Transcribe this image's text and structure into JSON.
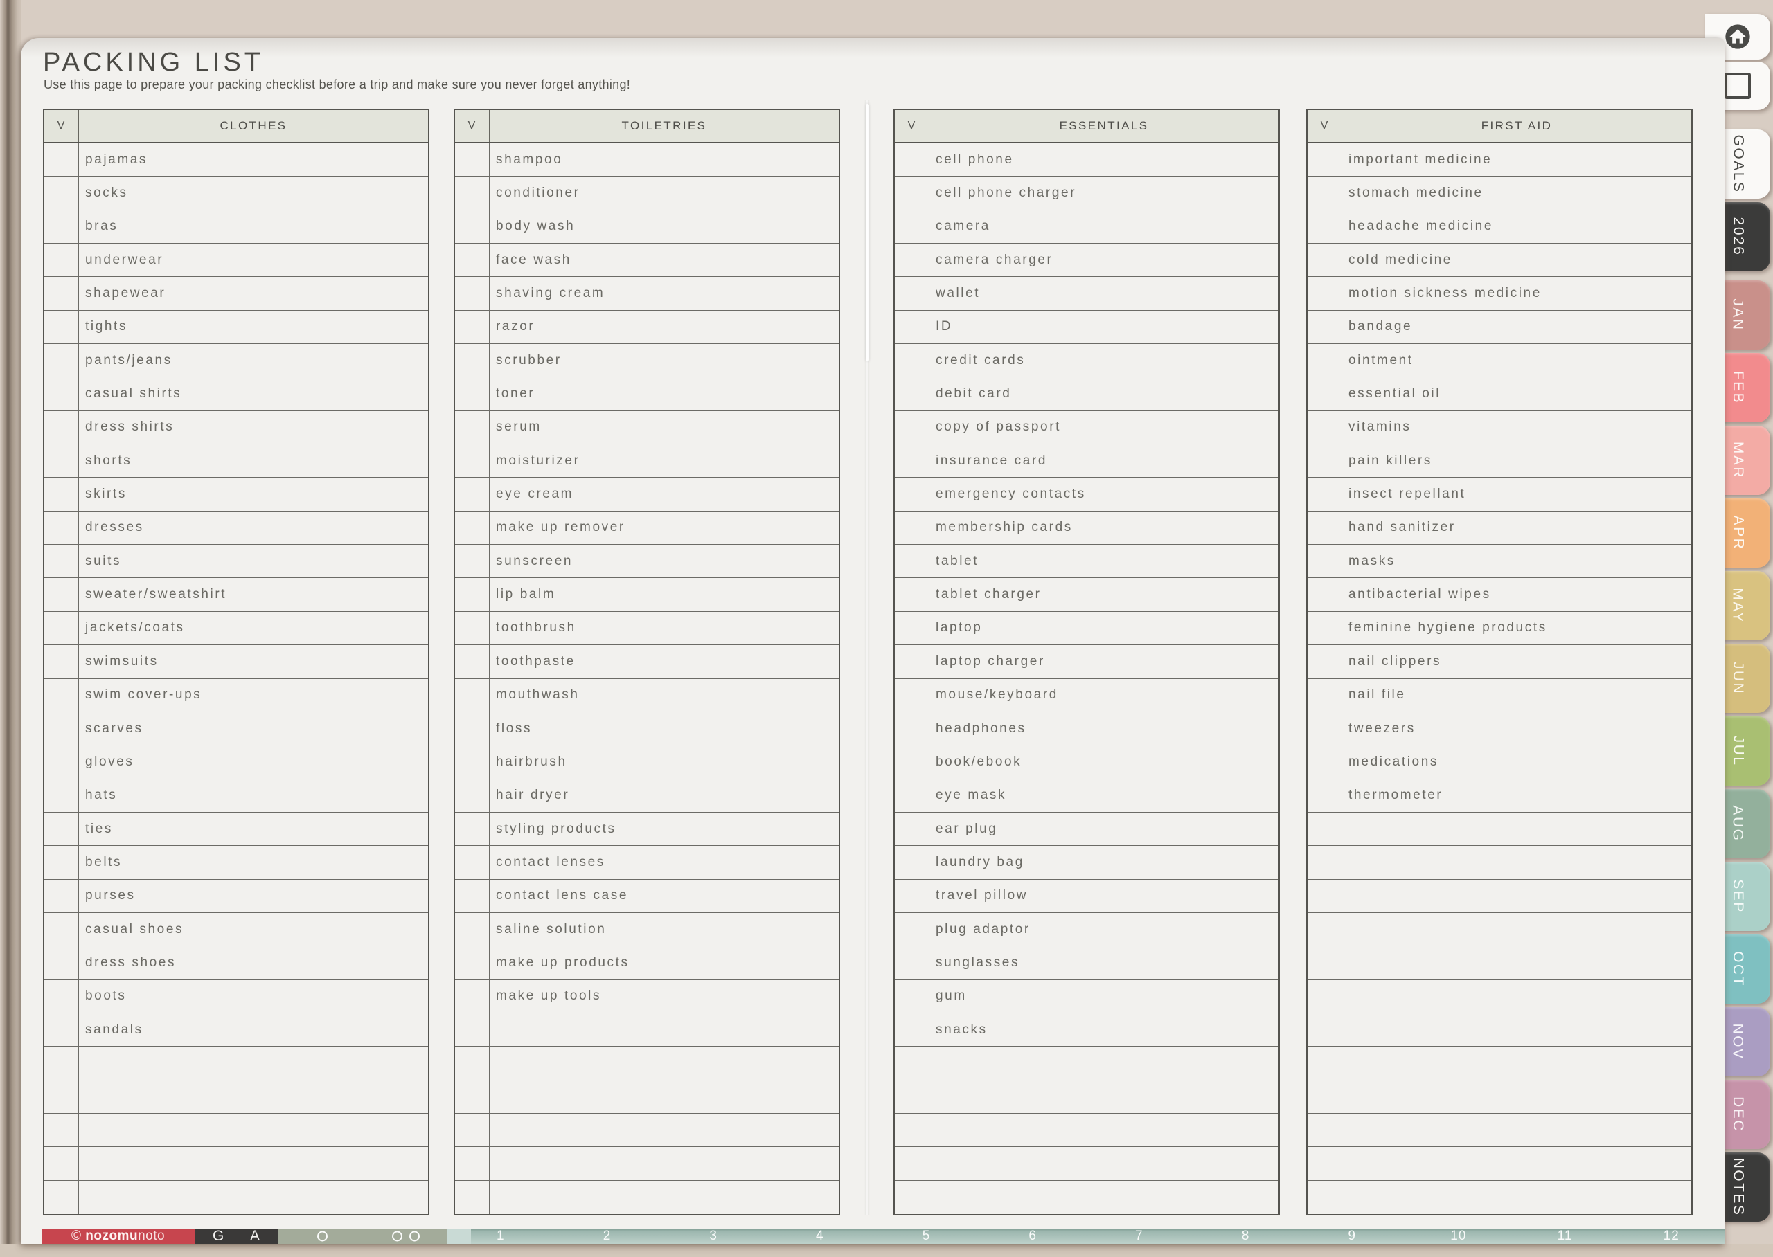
{
  "header": {
    "title": "PACKING LIST",
    "subtitle": "Use this page to prepare your packing checklist before a trip and make sure you never forget anything!"
  },
  "check_column_header": "V",
  "rows_per_table": 32,
  "tables": [
    {
      "title": "CLOTHES",
      "items": [
        "pajamas",
        "socks",
        "bras",
        "underwear",
        "shapewear",
        "tights",
        "pants/jeans",
        "casual shirts",
        "dress shirts",
        "shorts",
        "skirts",
        "dresses",
        "suits",
        "sweater/sweatshirt",
        "jackets/coats",
        "swimsuits",
        "swim cover-ups",
        "scarves",
        "gloves",
        "hats",
        "ties",
        "belts",
        "purses",
        "casual shoes",
        "dress shoes",
        "boots",
        "sandals"
      ]
    },
    {
      "title": "TOILETRIES",
      "items": [
        "shampoo",
        "conditioner",
        "body wash",
        "face wash",
        "shaving cream",
        "razor",
        "scrubber",
        "toner",
        "serum",
        "moisturizer",
        "eye cream",
        "make up remover",
        "sunscreen",
        "lip balm",
        "toothbrush",
        "toothpaste",
        "mouthwash",
        "floss",
        "hairbrush",
        "hair dryer",
        "styling products",
        "contact lenses",
        "contact lens case",
        "saline solution",
        "make up products",
        "make up tools"
      ]
    },
    {
      "title": "ESSENTIALS",
      "items": [
        "cell phone",
        "cell phone charger",
        "camera",
        "camera charger",
        "wallet",
        "ID",
        "credit cards",
        "debit card",
        "copy of passport",
        "insurance card",
        "emergency contacts",
        "membership cards",
        "tablet",
        "tablet charger",
        "laptop",
        "laptop charger",
        "mouse/keyboard",
        "headphones",
        "book/ebook",
        "eye mask",
        "ear plug",
        "laundry bag",
        "travel pillow",
        "plug adaptor",
        "sunglasses",
        "gum",
        "snacks"
      ]
    },
    {
      "title": "FIRST AID",
      "items": [
        "important medicine",
        "stomach medicine",
        "headache medicine",
        "cold medicine",
        "motion sickness medicine",
        "bandage",
        "ointment",
        "essential oil",
        "vitamins",
        "pain killers",
        "insect repellant",
        "hand sanitizer",
        "masks",
        "antibacterial wipes",
        "feminine hygiene products",
        "nail clippers",
        "nail file",
        "tweezers",
        "medications",
        "thermometer"
      ]
    }
  ],
  "sidebar": {
    "tabs": [
      {
        "name": "home",
        "type": "icon",
        "icon": "home-icon",
        "bg": "#faf9f7",
        "fg": "#4a4a47"
      },
      {
        "name": "overview",
        "type": "icon",
        "icon": "square-icon",
        "bg": "#faf9f7",
        "fg": "#4a4a47"
      },
      {
        "name": "goals",
        "label": "GOALS",
        "bg": "#faf9f7",
        "fg": "#4b4b47"
      },
      {
        "name": "2026",
        "label": "2026",
        "bg": "#3b3b3a",
        "fg": "#f5f4f2"
      },
      {
        "name": "jan",
        "label": "JAN",
        "bg": "#c9908a",
        "fg": "#faf3f1",
        "gap_before": true
      },
      {
        "name": "feb",
        "label": "FEB",
        "bg": "#f28b8d",
        "fg": "#fdf5f4"
      },
      {
        "name": "mar",
        "label": "MAR",
        "bg": "#f3aba5",
        "fg": "#fdf6f4"
      },
      {
        "name": "apr",
        "label": "APR",
        "bg": "#f2b177",
        "fg": "#fdf7f0"
      },
      {
        "name": "may",
        "label": "MAY",
        "bg": "#d9c280",
        "fg": "#fbf7ec"
      },
      {
        "name": "jun",
        "label": "JUN",
        "bg": "#d5be7d",
        "fg": "#fbf7ec"
      },
      {
        "name": "jul",
        "label": "JUL",
        "bg": "#a9bf72",
        "fg": "#f8faf0"
      },
      {
        "name": "aug",
        "label": "AUG",
        "bg": "#93b09c",
        "fg": "#f3f8f4"
      },
      {
        "name": "sep",
        "label": "SEP",
        "bg": "#abd0c8",
        "fg": "#f6fbf9"
      },
      {
        "name": "oct",
        "label": "OCT",
        "bg": "#7fc0c1",
        "fg": "#f2fafa"
      },
      {
        "name": "nov",
        "label": "NOV",
        "bg": "#aa9dc2",
        "fg": "#f7f5fa"
      },
      {
        "name": "dec",
        "label": "DEC",
        "bg": "#c693a9",
        "fg": "#faf4f7"
      },
      {
        "name": "notes",
        "label": "NOTES",
        "bg": "#3b3b3a",
        "fg": "#f5f4f2"
      }
    ]
  },
  "footer": {
    "copyright": {
      "symbol": "©",
      "brand_bold": "nozomu",
      "brand_rest": "noto"
    },
    "nav_letters": [
      "G",
      "A"
    ],
    "dot_groups": [
      1,
      2
    ],
    "month_numbers": [
      "1",
      "2",
      "3",
      "4",
      "5",
      "6",
      "7",
      "8",
      "9",
      "10",
      "11",
      "12"
    ],
    "colors": {
      "red": "#c7454e",
      "dark": "#3a3938",
      "sage": "#a3ab9a",
      "divider": "#c9dad5",
      "teal_top": "#7f9c93",
      "teal_bottom": "#bed1ca"
    }
  },
  "colors": {
    "background": "#d8cdc3",
    "page": "#f2f1ee",
    "table_header_bg": "#e3e4db",
    "table_border": "#55544f",
    "title_text": "#4b4a45",
    "item_text": "#6b6a64"
  }
}
